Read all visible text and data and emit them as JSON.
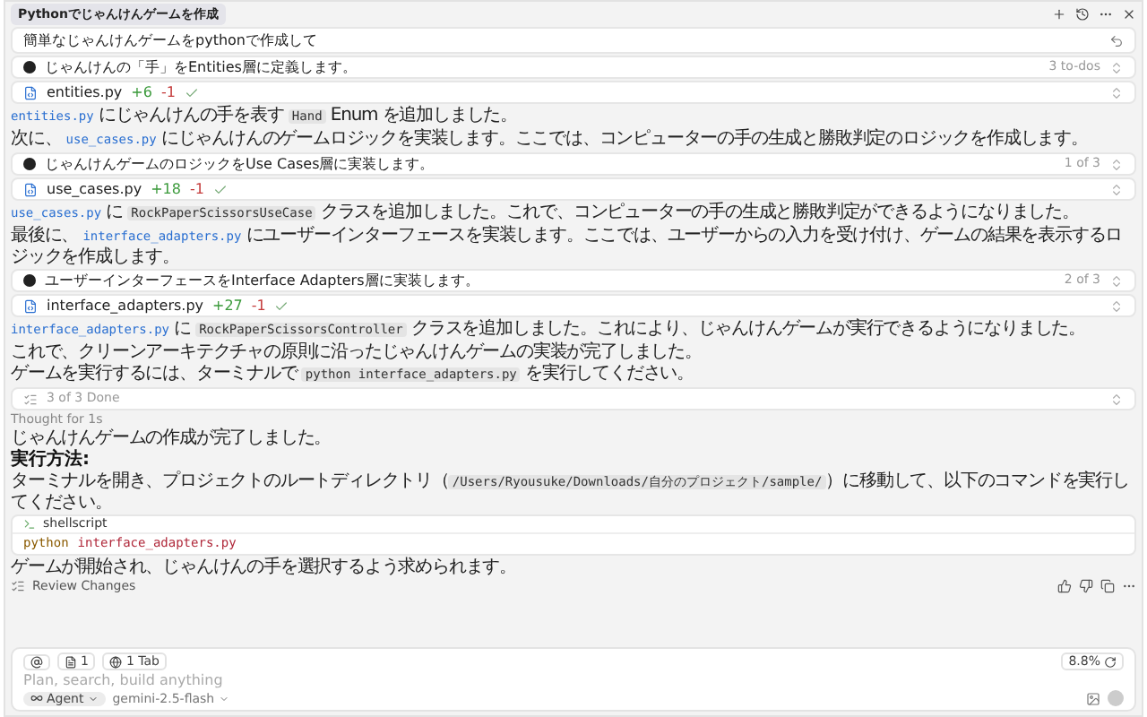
{
  "header": {
    "title": "Pythonでじゃんけんゲームを作成"
  },
  "prompt": {
    "text": "簡単なじゃんけんゲームをpythonで作成して"
  },
  "messages": [
    {
      "kind": "todo",
      "text": "じゃんけんの「手」をEntities層に定義します。",
      "progress": "3 to-dos"
    },
    {
      "kind": "file",
      "name": "entities.py",
      "added": "+6",
      "removed": "-1"
    },
    {
      "kind": "para",
      "parts": [
        {
          "kind": "link",
          "text": "entities.py"
        },
        {
          "kind": "text",
          "text": " にじゃんけんの手を表す "
        },
        {
          "kind": "code",
          "text": "Hand"
        },
        {
          "kind": "text",
          "text": " Enum を追加しました。"
        }
      ]
    },
    {
      "kind": "para",
      "parts": [
        {
          "kind": "text",
          "text": "次に、 "
        },
        {
          "kind": "link",
          "text": "use_cases.py"
        },
        {
          "kind": "text",
          "text": " にじゃんけんのゲームロジックを実装します。ここでは、コンピューターの手の生成と勝敗判定のロジックを作成します。"
        }
      ]
    },
    {
      "kind": "todo",
      "text": "じゃんけんゲームのロジックをUse Cases層に実装します。",
      "progress": "1 of 3"
    },
    {
      "kind": "file",
      "name": "use_cases.py",
      "added": "+18",
      "removed": "-1"
    },
    {
      "kind": "para",
      "parts": [
        {
          "kind": "link",
          "text": "use_cases.py"
        },
        {
          "kind": "text",
          "text": " に "
        },
        {
          "kind": "code",
          "text": "RockPaperScissorsUseCase"
        },
        {
          "kind": "text",
          "text": " クラスを追加しました。これで、コンピューターの手の生成と勝敗判定ができるようになりました。"
        }
      ]
    },
    {
      "kind": "para",
      "parts": [
        {
          "kind": "text",
          "text": "最後に、 "
        },
        {
          "kind": "link",
          "text": "interface_adapters.py"
        },
        {
          "kind": "text",
          "text": " にユーザーインターフェースを実装します。ここでは、ユーザーからの入力を受け付け、ゲームの結果を表示するロジックを作成します。"
        }
      ]
    },
    {
      "kind": "todo",
      "text": "ユーザーインターフェースをInterface Adapters層に実装します。",
      "progress": "2 of 3"
    },
    {
      "kind": "file",
      "name": "interface_adapters.py",
      "added": "+27",
      "removed": "-1"
    },
    {
      "kind": "para",
      "parts": [
        {
          "kind": "link",
          "text": "interface_adapters.py"
        },
        {
          "kind": "text",
          "text": " に "
        },
        {
          "kind": "code",
          "text": "RockPaperScissorsController"
        },
        {
          "kind": "text",
          "text": " クラスを追加しました。これにより、じゃんけんゲームが実行できるようになりました。"
        }
      ]
    },
    {
      "kind": "para",
      "parts": [
        {
          "kind": "text",
          "text": "これで、クリーンアーキテクチャの原則に沿ったじゃんけんゲームの実装が完了しました。"
        }
      ]
    },
    {
      "kind": "para",
      "parts": [
        {
          "kind": "text",
          "text": "ゲームを実行するには、ターミナルで "
        },
        {
          "kind": "code",
          "text": "python interface_adapters.py"
        },
        {
          "kind": "text",
          "text": " を実行してください。"
        }
      ]
    },
    {
      "kind": "done",
      "text": "3 of 3 Done"
    },
    {
      "kind": "thought",
      "label": "Thought",
      "duration": "for 1s"
    },
    {
      "kind": "para",
      "parts": [
        {
          "kind": "text",
          "text": "じゃんけんゲームの作成が完了しました。"
        }
      ]
    },
    {
      "kind": "heading",
      "text": "実行方法:"
    },
    {
      "kind": "para",
      "parts": [
        {
          "kind": "text",
          "text": "ターミナルを開き、プロジェクトのルートディレクトリ（"
        },
        {
          "kind": "code",
          "text": "/Users/Ryousuke/Downloads/自分のプロジェクト/sample/"
        },
        {
          "kind": "text",
          "text": "）に移動して、以下のコマンドを実行してください。"
        }
      ]
    },
    {
      "kind": "codeblock",
      "lang": "shellscript",
      "tokens": [
        {
          "kind": "keyword",
          "text": "python"
        },
        {
          "kind": "arg",
          "text": "interface_adapters.py"
        }
      ]
    },
    {
      "kind": "para",
      "parts": [
        {
          "kind": "text",
          "text": "ゲームが開始され、じゃんけんの手を選択するよう求められます。"
        }
      ]
    },
    {
      "kind": "review",
      "text": "Review Changes"
    }
  ],
  "composer": {
    "files": "1",
    "tabs": "1 Tab",
    "usage": "8.8%",
    "placeholder": "Plan, search, build anything",
    "mode": "Agent",
    "model": "gemini-2.5-flash"
  }
}
